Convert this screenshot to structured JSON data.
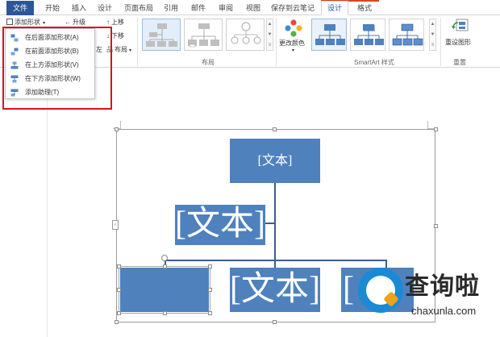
{
  "ribbon_tabs": [
    {
      "label": "文件"
    },
    {
      "label": "开始"
    },
    {
      "label": "插入"
    },
    {
      "label": "设计"
    },
    {
      "label": "页面布局"
    },
    {
      "label": "引用"
    },
    {
      "label": "邮件"
    },
    {
      "label": "审阅"
    },
    {
      "label": "视图"
    },
    {
      "label": "保存到云笔记"
    },
    {
      "label": "设计"
    },
    {
      "label": "格式"
    }
  ],
  "create_graphic": {
    "add_shape_label": "添加形状",
    "promote_label": "升级",
    "move_up_label": "上移",
    "move_down_label": "下移",
    "layout_label": "布局",
    "left_to_right_fragment": "左"
  },
  "groups": {
    "layouts_label": "布局",
    "change_colors_label": "更改颜色",
    "styles_label": "SmartArt 样式",
    "reset_group_label": "重置",
    "reset_graphic_label": "重设图形"
  },
  "add_shape_menu": [
    {
      "label": "在后面添加形状(A)"
    },
    {
      "label": "在前面添加形状(B)"
    },
    {
      "label": "在上方添加形状(V)"
    },
    {
      "label": "在下方添加形状(W)"
    },
    {
      "label": "添加助理(T)"
    }
  ],
  "smartart": {
    "top_node_text": "[文本]",
    "assistant_node_text": "[文本]",
    "child_middle_text": "[文本]",
    "child_right_text": "[",
    "side_tab_glyph": "‹"
  },
  "watermark": {
    "title": "查询啦",
    "url": "chaxunla.com"
  },
  "colors": {
    "accent_blue": "#2b579a",
    "node_fill": "#4f81bd",
    "highlight_red": "#d9111b",
    "watermark_blue": "#1a8ad4",
    "watermark_orange": "#f0a21a"
  }
}
